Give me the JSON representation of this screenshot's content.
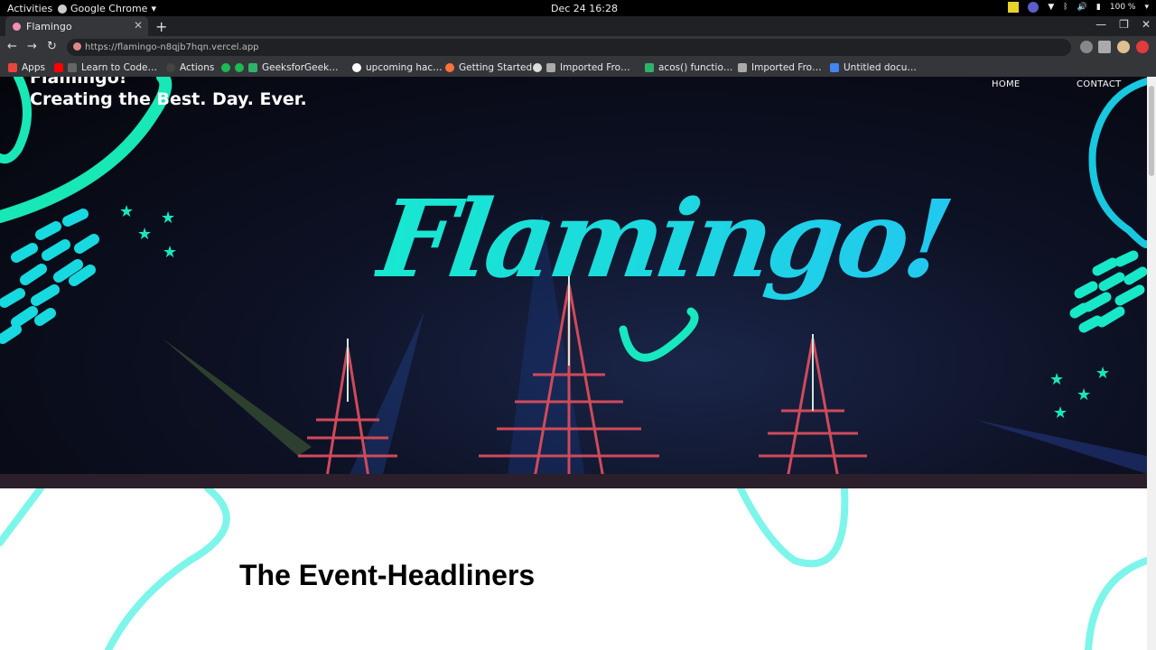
{
  "os": {
    "activities": "Activities",
    "app_name": "Google Chrome",
    "clock": "Dec 24  16:28",
    "battery": "100 %"
  },
  "browser": {
    "tab_title": "Flamingo",
    "url": "https://flamingo-n8qjb7hqn.vercel.app",
    "bookmarks": [
      {
        "label": "Apps",
        "color": "#e8453c"
      },
      {
        "label": "Learn to Code…",
        "color": "#ff0000"
      },
      {
        "label": "Actions",
        "color": "#8ab4f8"
      },
      {
        "label": "GeeksforGeek…",
        "color": "#2fb36b"
      },
      {
        "label": "upcoming hac…",
        "color": "#ffffff"
      },
      {
        "label": "Getting Started",
        "color": "#ff7139"
      },
      {
        "label": "Imported Fro…",
        "color": "#aaaaaa"
      },
      {
        "label": "acos() functio…",
        "color": "#2fb36b"
      },
      {
        "label": "Imported Fro…",
        "color": "#aaaaaa"
      },
      {
        "label": "Untitled docu…",
        "color": "#4285f4"
      }
    ]
  },
  "page": {
    "brand_line1": "Flamingo!",
    "brand_line2": "Creating the Best. Day. Ever.",
    "nav_home": "HOME",
    "nav_contact": "CONTACT",
    "hero_title": "Flamingo!",
    "section_title": "The Event-Headliners",
    "accent_color": "#17e8d0",
    "accent_color_2": "#22c8f0"
  }
}
